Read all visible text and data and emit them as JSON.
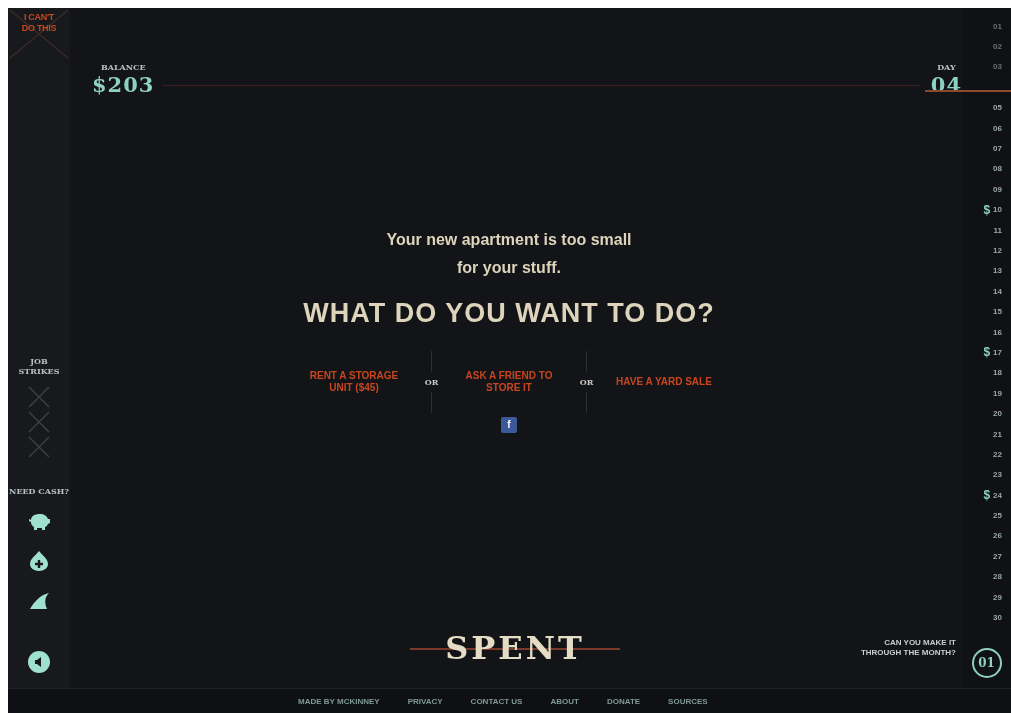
{
  "sidebar": {
    "quit_button": "I CAN'T DO THIS",
    "strikes_label": "JOB STRIKES",
    "cash_label": "NEED CASH?"
  },
  "balance": {
    "label": "BALANCE",
    "value": "$203"
  },
  "day": {
    "label": "DAY",
    "value": "04"
  },
  "prompt": {
    "message": "Your new apartment is too small for your stuff.",
    "question": "WHAT DO YOU WANT TO DO?",
    "choices": [
      {
        "kind": "option",
        "text": "RENT A STORAGE UNIT ($45)"
      },
      {
        "kind": "separator",
        "text": "OR"
      },
      {
        "kind": "option",
        "text": "ASK A FRIEND TO STORE IT"
      },
      {
        "kind": "separator",
        "text": "OR"
      },
      {
        "kind": "option",
        "text": "HAVE A YARD SALE"
      }
    ],
    "share_button": "f"
  },
  "days": [
    {
      "label": "01",
      "past": true
    },
    {
      "label": "02",
      "past": true
    },
    {
      "label": "03",
      "past": true
    },
    {
      "label": "05",
      "past": false
    },
    {
      "label": "06",
      "past": false
    },
    {
      "label": "07",
      "past": false
    },
    {
      "label": "08",
      "past": false
    },
    {
      "label": "09",
      "past": false
    },
    {
      "label": "10",
      "past": false,
      "marker": "$"
    },
    {
      "label": "11",
      "past": false
    },
    {
      "label": "12",
      "past": false
    },
    {
      "label": "13",
      "past": false
    },
    {
      "label": "14",
      "past": false
    },
    {
      "label": "15",
      "past": false
    },
    {
      "label": "16",
      "past": false
    },
    {
      "label": "17",
      "past": false,
      "marker": "$"
    },
    {
      "label": "18",
      "past": false
    },
    {
      "label": "19",
      "past": false
    },
    {
      "label": "20",
      "past": false
    },
    {
      "label": "21",
      "past": false
    },
    {
      "label": "22",
      "past": false
    },
    {
      "label": "23",
      "past": false
    },
    {
      "label": "24",
      "past": false,
      "marker": "$"
    },
    {
      "label": "25",
      "past": false
    },
    {
      "label": "26",
      "past": false
    },
    {
      "label": "27",
      "past": false
    },
    {
      "label": "28",
      "past": false
    },
    {
      "label": "29",
      "past": false
    },
    {
      "label": "30",
      "past": false
    }
  ],
  "logo": "SPENT",
  "tagline": "CAN YOU MAKE IT THROUGH THE MONTH?",
  "round": "01",
  "footer": [
    "MADE BY MCKINNEY",
    "PRIVACY",
    "CONTACT US",
    "ABOUT",
    "DONATE",
    "SOURCES"
  ]
}
